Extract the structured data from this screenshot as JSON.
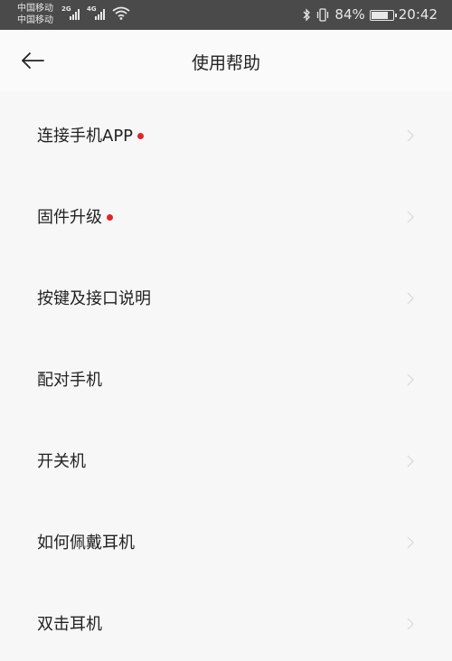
{
  "status_bar": {
    "carrier1": "中国移动",
    "carrier2": "中国移动",
    "net1": "2G",
    "net2": "4G",
    "battery_percent": "84%",
    "battery_level": 0.84,
    "time": "20:42",
    "icons": [
      "signal-icon",
      "wifi-icon",
      "bluetooth-icon",
      "vibrate-icon",
      "battery-icon"
    ]
  },
  "header": {
    "title": "使用帮助",
    "back_icon": "back-arrow-icon"
  },
  "menu": {
    "items": [
      {
        "label": "连接手机APP",
        "badge": true
      },
      {
        "label": "固件升级",
        "badge": true
      },
      {
        "label": "按键及接口说明",
        "badge": false
      },
      {
        "label": "配对手机",
        "badge": false
      },
      {
        "label": "开关机",
        "badge": false
      },
      {
        "label": "如何佩戴耳机",
        "badge": false
      },
      {
        "label": "双击耳机",
        "badge": false
      }
    ]
  },
  "colors": {
    "status_bg": "#4a4a4a",
    "page_bg": "#f7f7f7",
    "badge": "#e1252a"
  }
}
